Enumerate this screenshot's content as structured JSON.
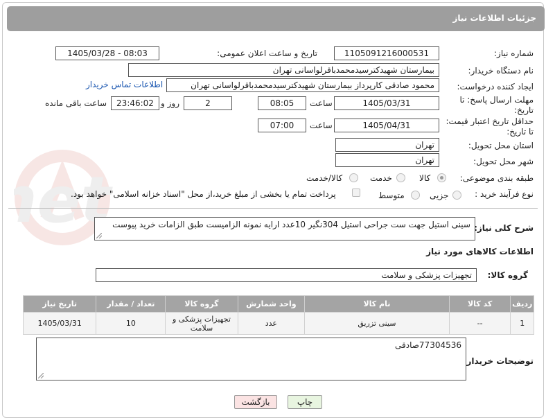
{
  "header": {
    "title": "جزئیات اطلاعات نیاز"
  },
  "form": {
    "need_number_label": "شماره نیاز:",
    "need_number": "1105091216000531",
    "announce_label": "تاریخ و ساعت اعلان عمومی:",
    "announce_value": "1405/03/28 - 08:03",
    "buyer_org_label": "نام دستگاه خریدار:",
    "buyer_org": "بیمارستان شهیدکترسیدمحمدباقرلواسانی تهران",
    "creator_label": "ایجاد کننده درخواست:",
    "creator": "محمود صادقی کارپرداز بیمارستان شهیدکترسیدمحمدباقرلواسانی تهران",
    "contact_link": "اطلاعات تماس خریدار",
    "reply_deadline_label_1": "مهلت ارسال پاسخ: تا",
    "reply_deadline_label_2": "تاریخ:",
    "reply_date": "1405/03/31",
    "time_label": "ساعت",
    "reply_time": "08:05",
    "days_value": "2",
    "days_label": "روز و",
    "remaining_time": "23:46:02",
    "remaining_label": "ساعت باقی مانده",
    "price_deadline_label_1": "حداقل تاریخ اعتبار قیمت:",
    "price_deadline_label_2": "تا تاریخ:",
    "price_date": "1405/04/31",
    "price_time": "07:00",
    "province_label": "استان محل تحویل:",
    "province": "تهران",
    "city_label": "شهر محل تحویل:",
    "city": "تهران",
    "category_label": "طبقه بندی موضوعی:",
    "category_options": [
      "کالا",
      "خدمت",
      "کالا/خدمت"
    ],
    "process_label": "نوع فرآیند خرید :",
    "process_options": [
      "جزیی",
      "متوسط"
    ],
    "payment_note": "پرداخت تمام یا بخشی از مبلغ خرید،از محل \"اسناد خزانه اسلامی\" خواهد بود."
  },
  "description": {
    "label": "شرح کلی نیاز:",
    "text": "سینی استیل جهت ست جراحی استیل 304نگیر 10عدد ارایه نمونه الزامیست طبق الزامات خرید پیوست"
  },
  "goods": {
    "section_title": "اطلاعات کالاهای مورد نیاز",
    "group_label": "گروه کالا:",
    "group_value": "تجهیزات پزشکی و سلامت",
    "columns": [
      "ردیف",
      "کد کالا",
      "نام کالا",
      "واحد شمارش",
      "گروه کالا",
      "تعداد / مقدار",
      "تاریخ نیاز"
    ],
    "rows": [
      {
        "row": "1",
        "code": "--",
        "name": "سینی تزریق",
        "unit": "عدد",
        "group": "تجهیزات پزشکی و سلامت",
        "qty": "10",
        "date": "1405/03/31"
      }
    ]
  },
  "buyer_notes": {
    "label": "توضیحات خریدار:",
    "text": "77304536صادقی"
  },
  "buttons": {
    "print": "چاپ",
    "back": "بازگشت"
  },
  "colors": {
    "title_bar": "#9e9e9e",
    "table_header": "#a4a4a4",
    "link": "#1a56b0",
    "print_btn": "#e8f5e0",
    "back_btn": "#fbe3e3"
  }
}
